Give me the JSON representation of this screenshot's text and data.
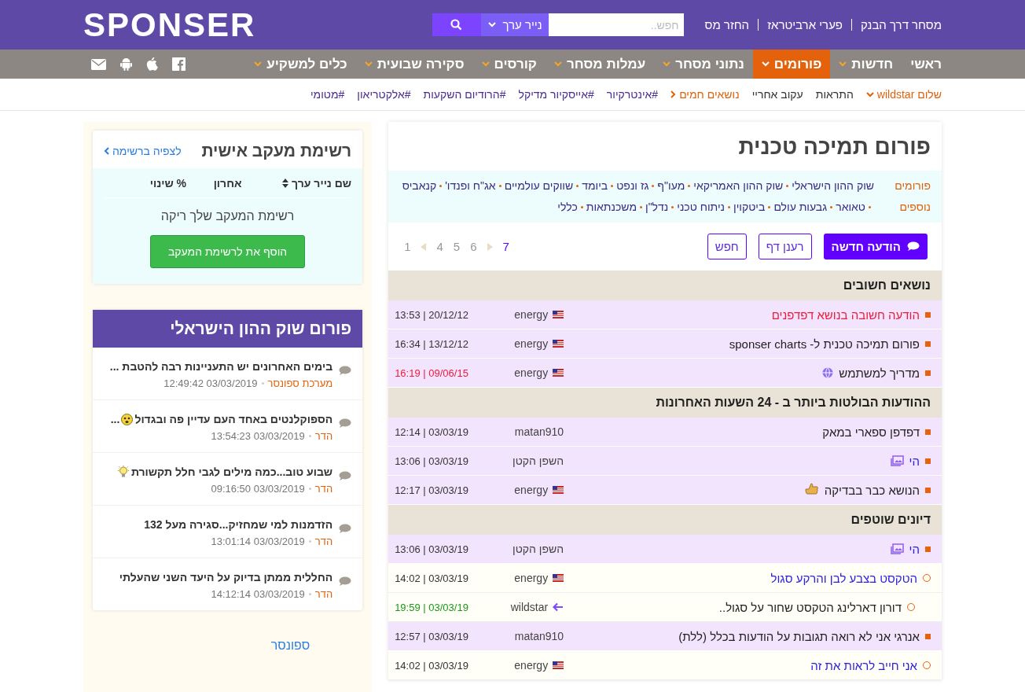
{
  "header": {
    "logo": "SPONSER",
    "top_links": [
      "מסחר דרך הבנק",
      "פערי ארביטראז",
      "החזר מס"
    ],
    "search": {
      "placeholder": "חפש..",
      "category": "נייר ערך"
    }
  },
  "nav": {
    "items": [
      {
        "label": "ראשי",
        "selected": false,
        "caret": false
      },
      {
        "label": "חדשות",
        "selected": false,
        "caret": true
      },
      {
        "label": "פורומים",
        "selected": true,
        "caret": true
      },
      {
        "label": "נתוני מסחר",
        "selected": false,
        "caret": true
      },
      {
        "label": "עמלות מסחר",
        "selected": false,
        "caret": true
      },
      {
        "label": "קורסים",
        "selected": false,
        "caret": true
      },
      {
        "label": "סקירה שבועית",
        "selected": false,
        "caret": true
      },
      {
        "label": "כלים למשקיע",
        "selected": false,
        "caret": true
      }
    ]
  },
  "subnav": {
    "items": [
      {
        "kind": "user",
        "label": "שלום wildstar"
      },
      {
        "kind": "plain",
        "label": "התראות"
      },
      {
        "kind": "plain",
        "label": "עקוב אחריי"
      },
      {
        "kind": "hot",
        "label": "נושאים חמים"
      },
      {
        "kind": "tag",
        "label": "#אינטרקיור"
      },
      {
        "kind": "tag",
        "label": "#אייסקיור מדיקל"
      },
      {
        "kind": "tag",
        "label": "#הרודיום השקעות"
      },
      {
        "kind": "tag",
        "label": "#אלקטריאון"
      },
      {
        "kind": "tag",
        "label": "#מטומי"
      }
    ]
  },
  "forum": {
    "title": "פורום תמיכה טכנית",
    "other_forums_label": "פורומים נוספים",
    "other_forums": [
      "שוק ההון הישראלי",
      "שוק ההון האמריקאי",
      "מעו\"ף",
      "גז ונפט",
      "ביומד",
      "שווקים עולמיים",
      "אג\"ח ופנדו'",
      "קנאביס",
      "טאואר",
      "גבעות עולם",
      "ביטקוין",
      "ניתוח טכני",
      "נדל\"ן",
      "משכנתאות",
      "כללי"
    ],
    "buttons": [
      {
        "kind": "primary",
        "label": "הודעה חדשה"
      },
      {
        "kind": "outline",
        "label": "רענן דף"
      },
      {
        "kind": "outline",
        "label": "חפש"
      }
    ],
    "pages": [
      {
        "label": "7",
        "selected": true
      },
      {
        "label": "6",
        "selected": false
      },
      {
        "label": "5",
        "selected": false
      },
      {
        "label": "4",
        "selected": false
      },
      {
        "label": "1",
        "selected": false
      }
    ],
    "sections": [
      {
        "title": "נושאים חשובים",
        "rows": [
          {
            "kind": "topic",
            "subject": "הודעה חשובה בנושא דפדפנים",
            "color": "#ee1c3a",
            "author": "energy",
            "author_badge": {
              "kind": "flag"
            },
            "date": {
              "text": "13:53 | 20/12/12"
            }
          },
          {
            "kind": "topic",
            "subject": "פורום תמיכה טכנית ל- sponser charts",
            "color": "#222222",
            "author": "energy",
            "author_badge": {
              "kind": "flag"
            },
            "date": {
              "text": "16:34 | 13/12/12"
            }
          },
          {
            "kind": "topic",
            "subject": "מדריך למשתמש",
            "color": "#222222",
            "subject_badge": {
              "kind": "globe"
            },
            "author": "energy",
            "author_badge": {
              "kind": "flag"
            },
            "date": {
              "text": "16:19 | 09/06/15",
              "color": "#ee1c3a"
            }
          }
        ]
      },
      {
        "title": "ההודעות הבולטות ביותר ב - 24 השעות האחרונות",
        "rows": [
          {
            "kind": "topic",
            "subject": "דפדפן ספארי במאק",
            "color": "#222222",
            "author": "matan910",
            "date": {
              "text": "12:14 | 03/03/19"
            }
          },
          {
            "kind": "topic",
            "subject": "הי",
            "color": "#2a1fe0",
            "subject_badge": {
              "kind": "image"
            },
            "author": "השפן הקטן",
            "date": {
              "text": "13:06 | 03/03/19"
            }
          },
          {
            "kind": "topic",
            "subject": "הנושא כבר בבדיקה",
            "color": "#222222",
            "subject_badge": {
              "kind": "thumb"
            },
            "author": "energy",
            "author_badge": {
              "kind": "flag"
            },
            "date": {
              "text": "12:17 | 03/03/19"
            }
          }
        ]
      },
      {
        "title": "דיונים שוטפים",
        "rows": [
          {
            "kind": "topic",
            "subject": "הי",
            "color": "#2a1fe0",
            "subject_badge": {
              "kind": "image"
            },
            "author": "השפן הקטן",
            "date": {
              "text": "13:06 | 03/03/19"
            }
          },
          {
            "kind": "reply",
            "subject": "הטקסט בצבע לבן והרקע סגול",
            "color": "#2a1fe0",
            "author": "energy",
            "author_badge": {
              "kind": "flag"
            },
            "date": {
              "text": "14:02 | 03/03/19"
            },
            "children": [
              {
                "kind": "reply",
                "subject": "דורון דארלינג הטקסט שחור על סגול..",
                "color": "#222222",
                "author": "wildstar",
                "author_badge": {
                  "kind": "arrow"
                },
                "date": {
                  "text": "19:59 | 03/03/19",
                  "color": "#1a9a1a"
                }
              }
            ]
          },
          {
            "kind": "topic",
            "subject": "אנרגי אני לא רואה תגובות על הודעות בכלל (ללת)",
            "color": "#222222",
            "author": "matan910",
            "date": {
              "text": "12:57 | 03/03/19"
            }
          },
          {
            "kind": "reply",
            "subject": "אני חייב לראות את זה",
            "color": "#2a1fe0",
            "author": "energy",
            "author_badge": {
              "kind": "flag"
            },
            "date": {
              "text": "14:02 | 03/03/19"
            }
          }
        ]
      }
    ]
  },
  "watchlist": {
    "title": "רשימת מעקב אישית",
    "view_link": "לצפיה ברשימה",
    "columns": [
      {
        "label": "שם נייר ערך",
        "sortable": true
      },
      {
        "label": "אחרון",
        "sortable": false
      },
      {
        "label": "% שינוי",
        "sortable": false
      }
    ],
    "empty_text": "רשימת המעקב שלך ריקה",
    "add_button": "הוסף את לרשימת המעקב"
  },
  "forum_widget": {
    "title": "פורום שוק ההון הישראלי",
    "posts": [
      {
        "title": "בימים האחרונים יש התעניינות רבה להטבת ...",
        "author": "מערכת ספונסר",
        "datetime": "12:49:42 03/03/2019"
      },
      {
        "title": "הספוקלנטים באחד העם עדיין פה ובגדול",
        "emoji": {
          "kind": "face"
        },
        "suffix": "...",
        "author": "הדר",
        "datetime": "13:54:23 03/03/2019"
      },
      {
        "title": "שבוע טוב...כמה מילים לגבי חלל תקשורת",
        "emoji": {
          "kind": "bulb"
        },
        "author": "הדר",
        "datetime": "09:16:50 03/03/2019"
      },
      {
        "title": "הזדמנות למי שמחזיק...סגירה מעל 132",
        "author": "הדר",
        "datetime": "13:01:14 03/03/2019"
      },
      {
        "title": "החללית ממתן בדיוק על היעד השני שהעלתי",
        "author": "הדר",
        "datetime": "14:12:14 03/03/2019"
      }
    ]
  },
  "sponsor_link": "ספונסר"
}
